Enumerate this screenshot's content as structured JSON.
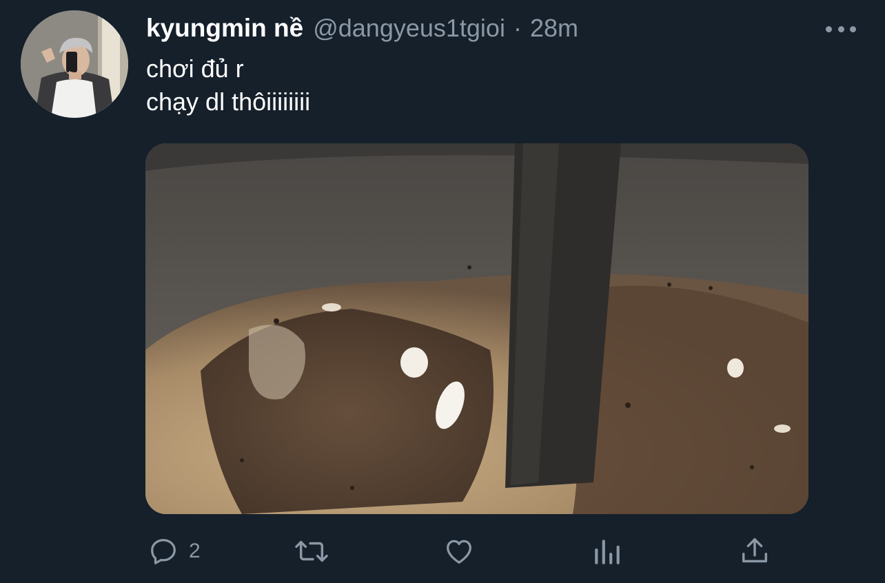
{
  "tweet": {
    "author": {
      "display_name": "kyungmin nề",
      "handle": "@dangyeus1tgioi"
    },
    "separator": "·",
    "time": "28m",
    "text_lines": [
      "chơi đủ r",
      "chạy dl thôiiiiiiii"
    ],
    "actions": {
      "reply": {
        "icon": "reply-icon",
        "count": "2"
      },
      "retweet": {
        "icon": "retweet-icon"
      },
      "like": {
        "icon": "heart-icon"
      },
      "analytics": {
        "icon": "analytics-icon"
      },
      "share": {
        "icon": "share-icon"
      }
    },
    "colors": {
      "background": "#15202b",
      "secondary_text": "#8b98a5",
      "primary_text": "#ffffff"
    }
  }
}
